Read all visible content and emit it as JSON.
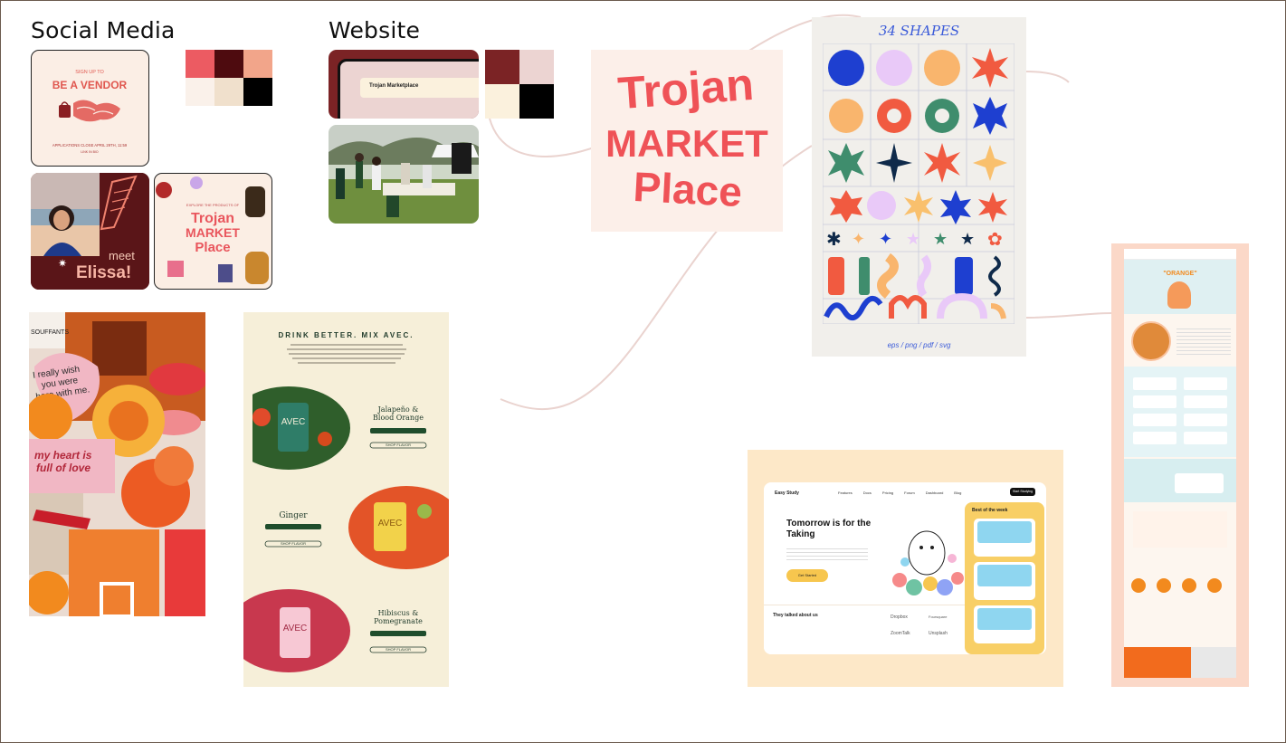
{
  "headings": {
    "social": "Social Media",
    "website": "Website"
  },
  "palettes": {
    "social": [
      "#ec5b62",
      "#4e0b0f",
      "#f2a58a",
      "#faf1ea",
      "#f0e0cc",
      "#000000"
    ],
    "website": [
      "#7b2325",
      "#ecd4d2",
      "#fbf1dd",
      "#000000"
    ]
  },
  "vendor_card": {
    "line1": "SIGN UP TO",
    "line2": "BE A VENDOR",
    "line3": "APPLICATIONS CLOSE APRIL 29TH, 11:59",
    "line4": "LINK IN BIO"
  },
  "meet_card": {
    "meet": "meet",
    "name": "Elissa!"
  },
  "explore_card": {
    "top": "EXPLORE THE PRODUCTS OF",
    "w1": "Trojan",
    "w2": "MARKET",
    "w3": "Place"
  },
  "website_card": {
    "title": "Trojan Marketplace"
  },
  "logo": {
    "w1": "Trojan",
    "w2": "MARKET",
    "w3": "Place"
  },
  "shapes": {
    "title": "34 SHAPES",
    "footer": "eps / png / pdf / svg"
  },
  "collage": {
    "note1": "I really wish you were here with me.",
    "note2": "my heart is full of love",
    "tag": "SOUFFANTS"
  },
  "avec": {
    "title": "DRINK BETTER. MIX AVEC.",
    "flavors": [
      {
        "name": "Jalapeño & Blood Orange",
        "btn": "SHOP FLAVOR"
      },
      {
        "name": "Ginger",
        "btn": "SHOP FLAVOR"
      },
      {
        "name": "Hibiscus & Pomegranate",
        "btn": "SHOP FLAVOR"
      }
    ]
  },
  "easy_study": {
    "brand": "Easy Study",
    "nav": [
      "Features",
      "Docs",
      "Pricing",
      "Forum",
      "Dashboard",
      "Blog"
    ],
    "cta_top": "Start Studying",
    "headline": "Tomorrow is for the Taking",
    "cta": "Get Started",
    "best": "Best of the week",
    "talked": "They talked about us",
    "logos": [
      "Dropbox",
      "Foursquare",
      "ZoomTalk",
      "Unsplash"
    ]
  },
  "orange_site": {
    "hero": "\"ORANGE\""
  }
}
